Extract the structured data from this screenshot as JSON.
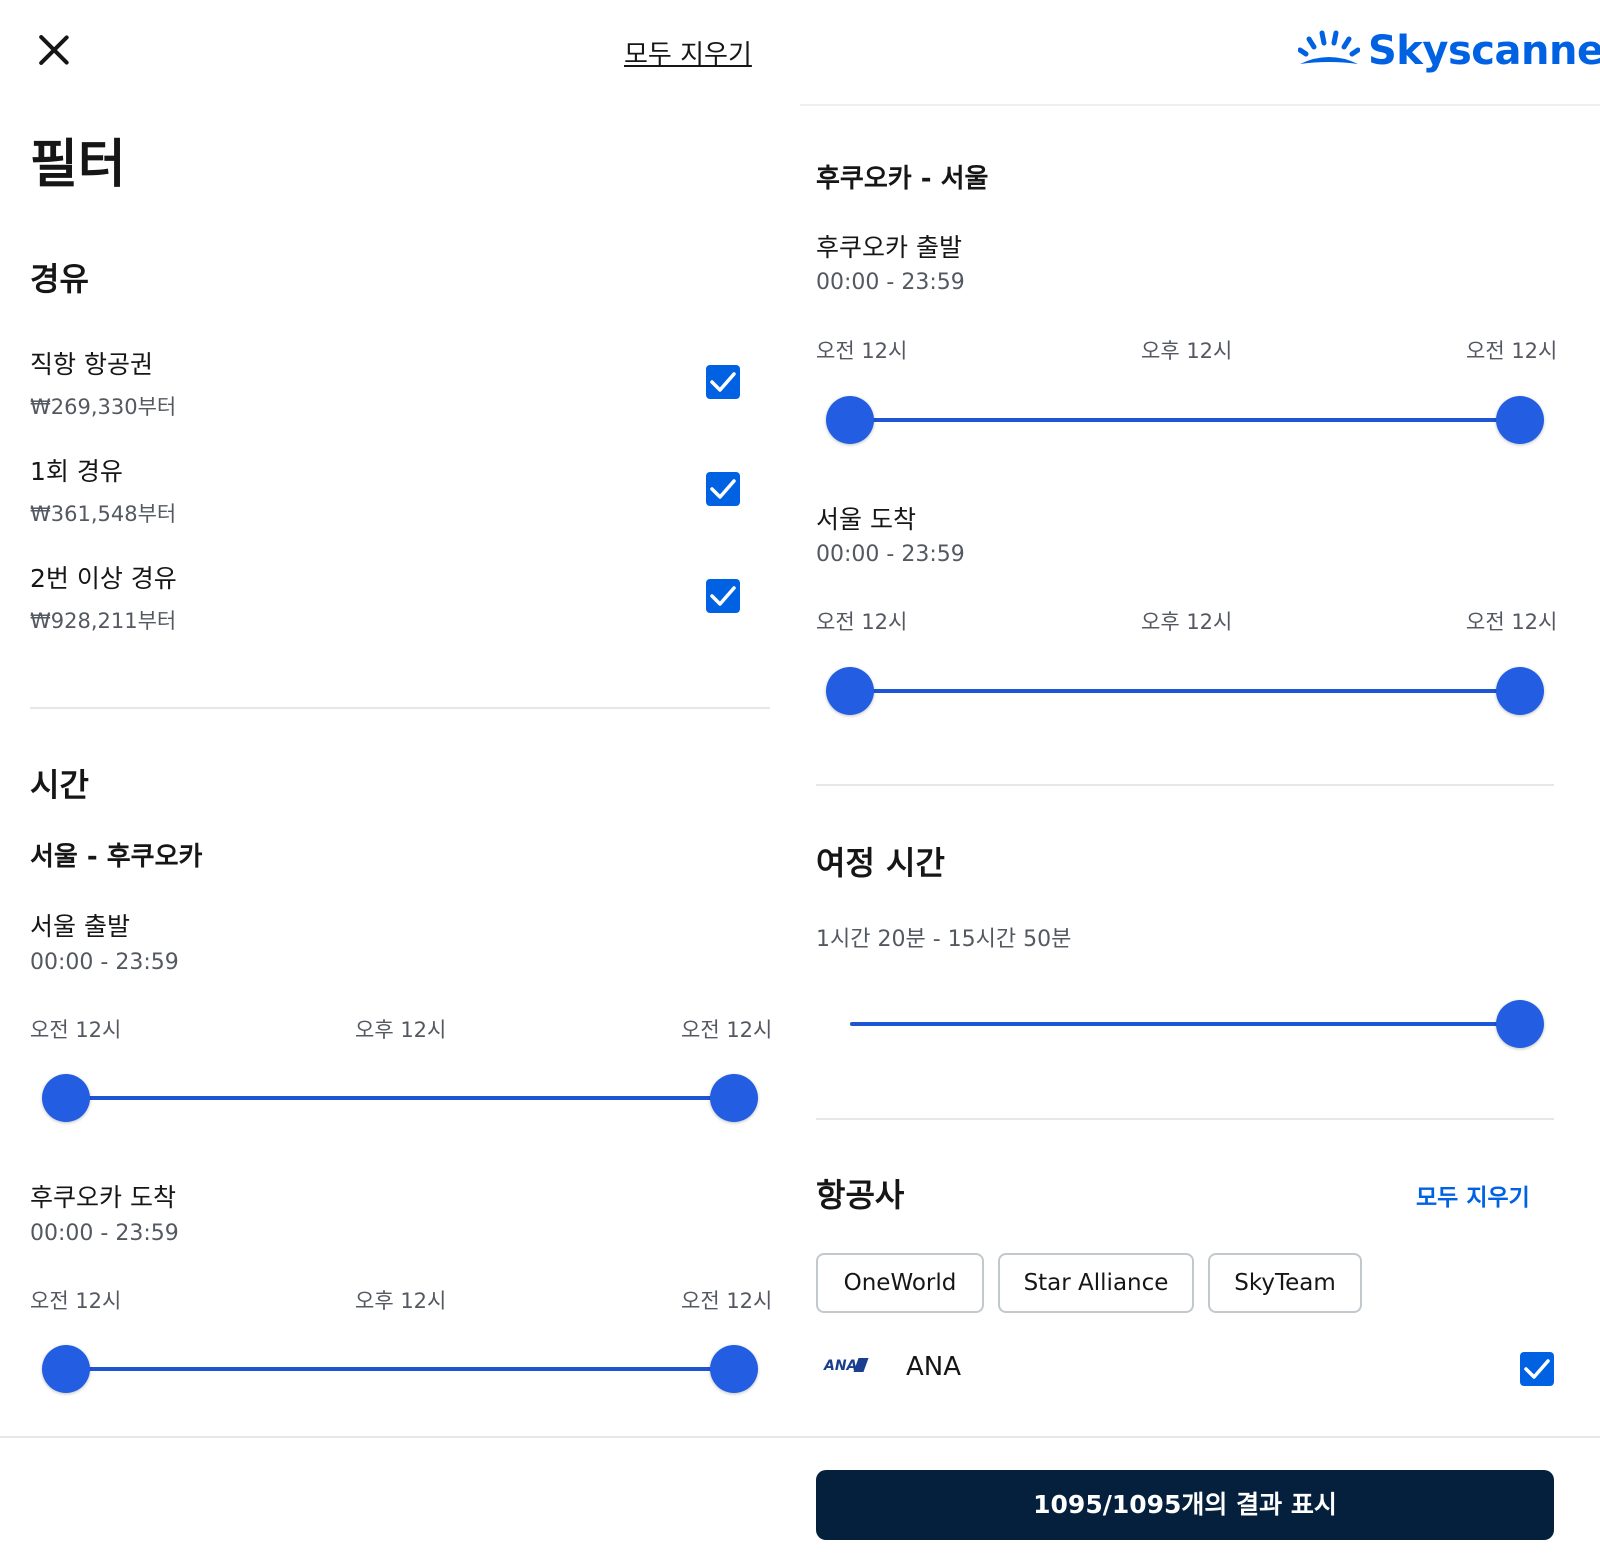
{
  "left": {
    "clear_all": "모두 지우기",
    "title": "필터",
    "stops": {
      "title": "경유",
      "items": [
        {
          "label": "직항 항공권",
          "price": "₩269,330부터",
          "checked": true
        },
        {
          "label": "1회 경유",
          "price": "₩361,548부터",
          "checked": true
        },
        {
          "label": "2번 이상 경유",
          "price": "₩928,211부터",
          "checked": true
        }
      ]
    },
    "time": {
      "title": "시간",
      "route": "서울 - 후쿠오카",
      "departure": {
        "label": "서울 출발",
        "range": "00:00 - 23:59",
        "ticks": [
          "오전 12시",
          "오후 12시",
          "오전 12시"
        ],
        "value_min": 0,
        "value_max": 1
      },
      "arrival": {
        "label": "후쿠오카 도착",
        "range": "00:00 - 23:59",
        "ticks": [
          "오전 12시",
          "오후 12시",
          "오전 12시"
        ],
        "value_min": 0,
        "value_max": 1
      }
    }
  },
  "right": {
    "brand": "Skyscanner",
    "return_route": "후쿠오카 - 서울",
    "departure": {
      "label": "후쿠오카 출발",
      "range": "00:00 - 23:59",
      "ticks": [
        "오전 12시",
        "오후 12시",
        "오전 12시"
      ],
      "value_min": 0,
      "value_max": 1
    },
    "arrival": {
      "label": "서울 도착",
      "range": "00:00 - 23:59",
      "ticks": [
        "오전 12시",
        "오후 12시",
        "오전 12시"
      ],
      "value_min": 0,
      "value_max": 1
    },
    "duration": {
      "title": "여정 시간",
      "range": "1시간 20분 - 15시간 50분",
      "value": 1
    },
    "airlines": {
      "title": "항공사",
      "clear": "모두 지우기",
      "alliances": [
        "OneWorld",
        "Star Alliance",
        "SkyTeam"
      ],
      "items": [
        {
          "logo_text": "ANA",
          "name": "ANA",
          "checked": true
        }
      ]
    },
    "show_results": "1095/1095개의 결과 표시"
  },
  "colors": {
    "accent": "#0062e3",
    "slider": "#235ee2",
    "button": "#05203c",
    "muted_text": "#545860",
    "divider": "#e6e7ea"
  }
}
